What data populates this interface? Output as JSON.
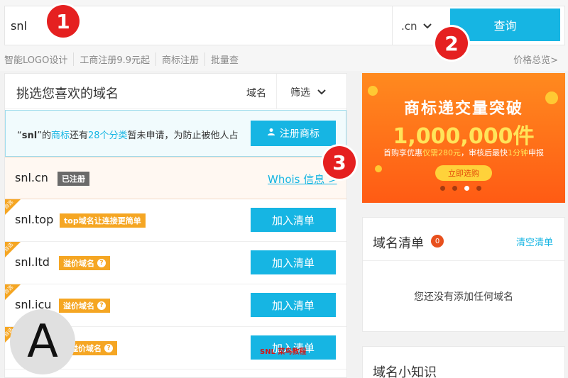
{
  "search": {
    "query": "snl",
    "tld": ".cn",
    "button_label": "查询"
  },
  "quick_links": [
    "智能LOGO设计",
    "工商注册9.9元起",
    "商标注册",
    "批量查"
  ],
  "price_link": "价格总览>",
  "steps": [
    "1",
    "2",
    "3"
  ],
  "results": {
    "title": "挑选您喜欢的域名",
    "sort_label": "域名",
    "filter_label": "筛选",
    "notice": {
      "prefix": "“",
      "name": "snl",
      "mid1": "”的",
      "link1": "商标",
      "mid2": "还有",
      "link2": "28个分类",
      "suffix": "暂未申请，为防止被他人占",
      "button_label": "注册商标"
    },
    "rows": [
      {
        "domain": "snl.cn",
        "tag": "已注册",
        "tag_style": "grey",
        "action": "Whois 信息 >",
        "ribbon": ""
      },
      {
        "domain": "snl.top",
        "tag": "top域名让连接更简单",
        "tag_style": "orange",
        "action": "加入清单",
        "ribbon": "自选"
      },
      {
        "domain": "snl.ltd",
        "tag": "溢价域名",
        "tag_style": "orange",
        "action": "加入清单",
        "ribbon": "自选"
      },
      {
        "domain": "snl.icu",
        "tag": "溢价域名",
        "tag_style": "orange",
        "action": "加入清单",
        "ribbon": "自选"
      },
      {
        "domain": "snl",
        "tag": "溢价域名",
        "tag_style": "orange",
        "action": "加入清单",
        "ribbon": "自选"
      }
    ]
  },
  "banner": {
    "title": "商标递交量突破",
    "number": "1,000,000件",
    "sub_a": "首购享优惠",
    "sub_b": "仅需280元",
    "sub_c": "，审核后最快",
    "sub_d": "1分钟",
    "sub_e": "申报",
    "cta": "立即选购",
    "slides": 4,
    "active_slide": 3
  },
  "cart": {
    "title": "域名清单",
    "count": "0",
    "clear_label": "清空清单",
    "empty_text": "您还没有添加任何域名"
  },
  "tips": {
    "title": "域名小知识"
  },
  "overlay": {
    "letter": "A",
    "watermark": "SNL 菜鸟教程"
  },
  "colors": {
    "accent": "#16b5e3",
    "badge_red": "#e52020",
    "tag_orange": "#f5a623",
    "tag_grey": "#6a6a6a",
    "banner_orange": "#ff5b14"
  }
}
